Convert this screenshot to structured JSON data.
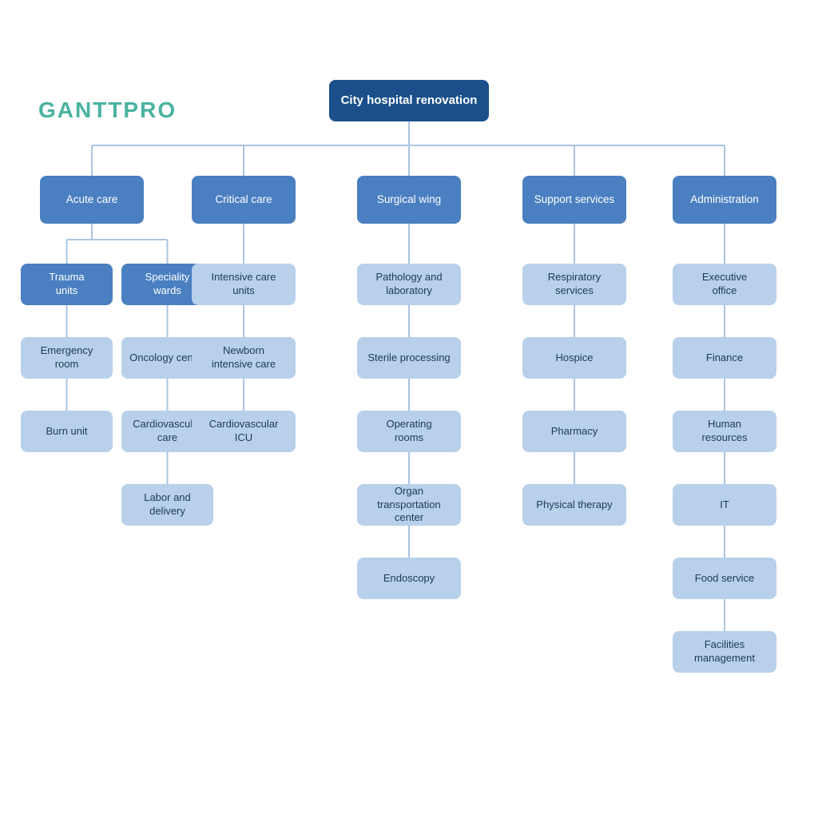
{
  "logo": "GANTTPRO",
  "chart": {
    "root": {
      "label": "City hospital renovation",
      "id": "root"
    },
    "level1": [
      {
        "label": "Acute care",
        "id": "acute"
      },
      {
        "label": "Critical\ncare",
        "id": "critical"
      },
      {
        "label": "Surgical wing",
        "id": "surgical"
      },
      {
        "label": "Support\nservices",
        "id": "support"
      },
      {
        "label": "Administration",
        "id": "admin"
      }
    ],
    "acute_sub": {
      "trauma": {
        "label": "Trauma\nunits",
        "children": [
          "Emergency\nroom",
          "Burn unit"
        ]
      },
      "speciality": {
        "label": "Speciality\nwards",
        "children": [
          "Oncology center",
          "Cardiovascular\ncare",
          "Labor and\ndelivery"
        ]
      }
    },
    "critical_children": [
      "Intensive care\nunits",
      "Newborn\nintensive care",
      "Cardiovascular\nICU"
    ],
    "surgical_children": [
      "Pathology and\nlaboratory",
      "Sterile processing",
      "Operating\nrooms",
      "Organ transportation\ncenter",
      "Endoscopy"
    ],
    "support_children": [
      "Respiratory\nservices",
      "Hospice",
      "Pharmacy",
      "Physical therapy"
    ],
    "admin_children": [
      "Executive\noffice",
      "Finance",
      "Human\nresources",
      "IT",
      "Food service",
      "Facilities\nmanagement"
    ]
  },
  "colors": {
    "root_bg": "#1a4f8a",
    "l1_bg": "#4a7fc1",
    "l2_bg": "#b8d0ea",
    "l2_text": "#1a3a5c",
    "connector": "#aac4e0",
    "logo": "#4ab3a0"
  }
}
